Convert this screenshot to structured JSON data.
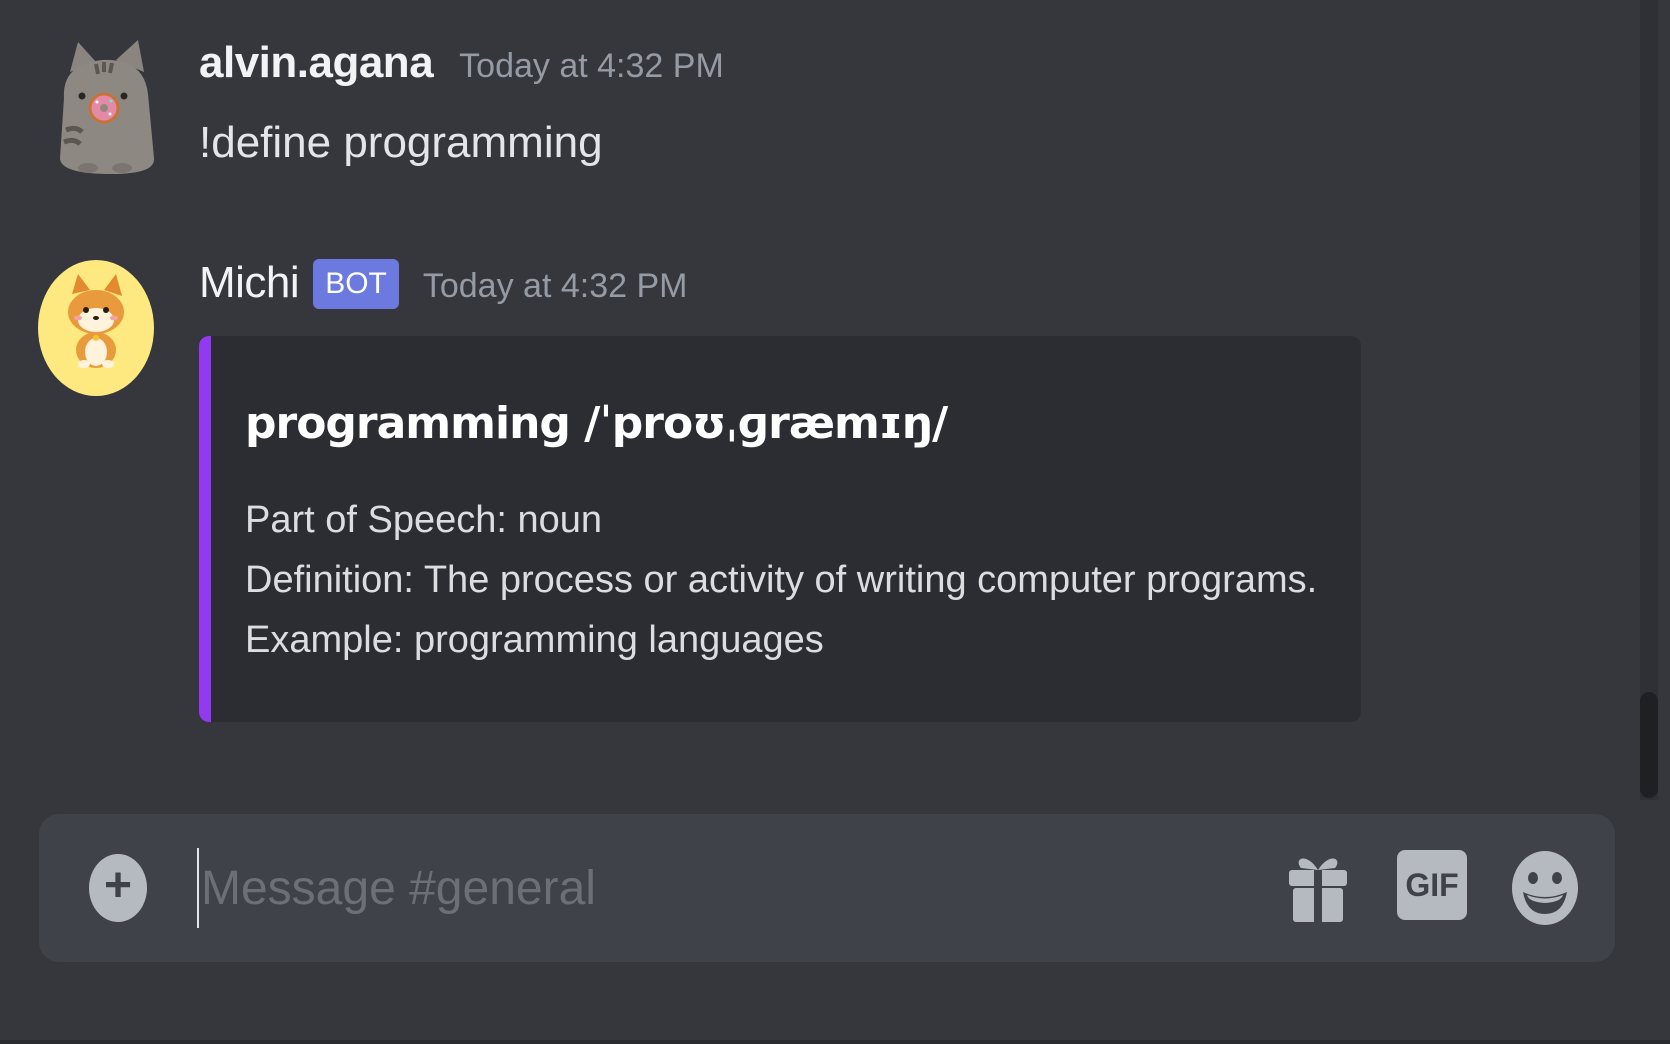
{
  "messages": [
    {
      "author": "alvin.agana",
      "timestamp": "Today at 4:32 PM",
      "content": "!define programming",
      "avatar_icon": "pusheen-cat-avatar"
    },
    {
      "author": "Michi",
      "badge": "BOT",
      "timestamp": "Today at 4:32 PM",
      "avatar_icon": "shiba-dog-avatar",
      "embed": {
        "accent_color": "#9339f2",
        "title": "programming /ˈproʊˌɡræmɪŋ/",
        "lines": [
          "Part of Speech: noun",
          "Definition: The process or activity of writing computer programs.",
          "Example: programming languages"
        ]
      }
    }
  ],
  "composer": {
    "placeholder": "Message #general",
    "value": "",
    "gif_label": "GIF",
    "icons": [
      "plus-icon",
      "gift-icon",
      "gif-icon",
      "emoji-icon"
    ]
  },
  "colors": {
    "background": "#36373d",
    "composer_bg": "#404249",
    "bot_badge": "#6c7ae0",
    "embed_bg": "#2c2d32"
  }
}
